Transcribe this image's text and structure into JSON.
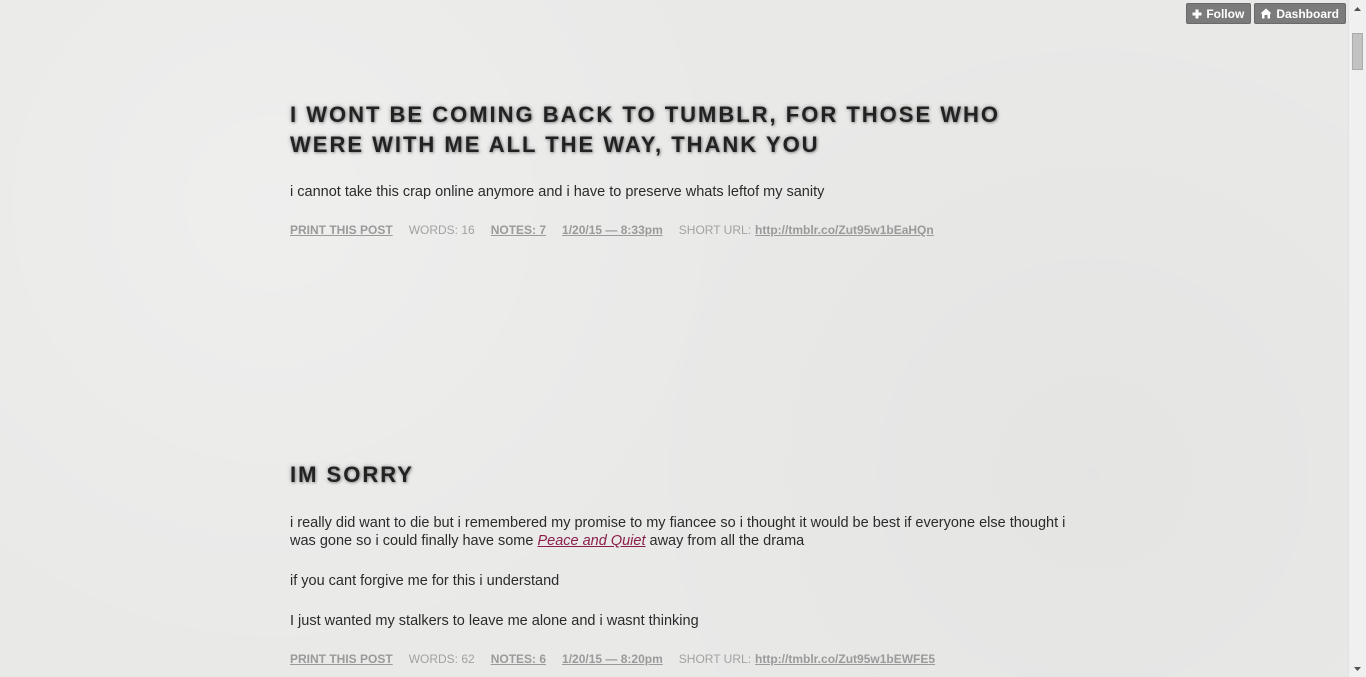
{
  "controls": {
    "follow_label": "Follow",
    "dashboard_label": "Dashboard"
  },
  "posts": [
    {
      "title_line1": "I WONT BE COMING BACK TO TUMBLR, FOR THOSE WHO",
      "title_line2": "WERE WITH ME ALL THE WAY, THANK YOU",
      "body": "i cannot take this crap online anymore and i have to preserve whats leftof my sanity",
      "meta": {
        "print": "PRINT THIS POST",
        "words": "WORDS: 16",
        "notes": "NOTES: 7",
        "date": "1/20/15 — 8:33pm",
        "short_url_label": "SHORT URL:",
        "short_url": "http://tmblr.co/Zut95w1bEaHQn"
      }
    },
    {
      "title": "IM SORRY",
      "para1_before": "i really did want to die but i remembered my promise to my fiancee so i thought it would be best if everyone else thought i was gone so i could finally have some ",
      "para1_link": "Peace and Quiet",
      "para1_after": " away from all the drama",
      "para2": "if you cant forgive me for this i understand",
      "para3": "I just wanted my stalkers to leave me alone and i wasnt thinking",
      "meta": {
        "print": "PRINT THIS POST",
        "words": "WORDS: 62",
        "notes": "NOTES: 6",
        "date": "1/20/15 — 8:20pm",
        "short_url_label": "SHORT URL:",
        "short_url": "http://tmblr.co/Zut95w1bEWFE5"
      }
    }
  ]
}
